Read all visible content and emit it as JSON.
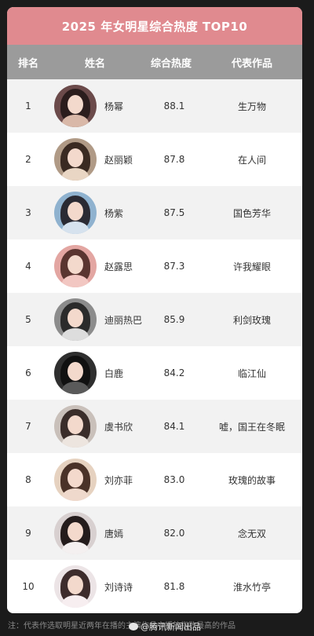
{
  "title": "2025 年女明星综合热度 TOP10",
  "header": {
    "rank": "排名",
    "name": "姓名",
    "score": "综合热度",
    "work": "代表作品"
  },
  "rows": [
    {
      "rank": "1",
      "name": "杨幂",
      "score": "88.1",
      "work": "生万物",
      "bg": "#6b4a4a",
      "hair": "#2b1d1d",
      "body": "#d9b8a8"
    },
    {
      "rank": "2",
      "name": "赵丽颖",
      "score": "87.8",
      "work": "在人间",
      "bg": "#b09a86",
      "hair": "#3a2a22",
      "body": "#e9d6c4"
    },
    {
      "rank": "3",
      "name": "杨紫",
      "score": "87.5",
      "work": "国色芳华",
      "bg": "#8fb2cf",
      "hair": "#2a2a33",
      "body": "#d6e2ee"
    },
    {
      "rank": "4",
      "name": "赵露思",
      "score": "87.3",
      "work": "许我耀眼",
      "bg": "#e3a6a2",
      "hair": "#5a3530",
      "body": "#f2c7c2"
    },
    {
      "rank": "5",
      "name": "迪丽热巴",
      "score": "85.9",
      "work": "利剑玫瑰",
      "bg": "#8c8c8c",
      "hair": "#2b2b2b",
      "body": "#dddddd"
    },
    {
      "rank": "6",
      "name": "白鹿",
      "score": "84.2",
      "work": "临江仙",
      "bg": "#2f2f2f",
      "hair": "#111111",
      "body": "#5a5a5a"
    },
    {
      "rank": "7",
      "name": "虞书欣",
      "score": "84.1",
      "work": "嘘，国王在冬眠",
      "bg": "#c9c0ba",
      "hair": "#3a2d2a",
      "body": "#ede5df"
    },
    {
      "rank": "8",
      "name": "刘亦菲",
      "score": "83.0",
      "work": "玫瑰的故事",
      "bg": "#e6d2c0",
      "hair": "#4a3228",
      "body": "#efd9cc"
    },
    {
      "rank": "9",
      "name": "唐嫣",
      "score": "82.0",
      "work": "念无双",
      "bg": "#d8d0d0",
      "hair": "#241c1c",
      "body": "#f4f0f0"
    },
    {
      "rank": "10",
      "name": "刘诗诗",
      "score": "81.8",
      "work": "淮水竹亭",
      "bg": "#ece4e6",
      "hair": "#3d2c2c",
      "body": "#f7eef0"
    }
  ],
  "footer": "注：代表作选取明星近两年在播的主演作品中播放指数最高的作品",
  "watermark": "@腾讯新闻出品",
  "colors": {
    "title_bar": "#e08a8f",
    "header_bar": "#9b9b9b",
    "row_alt": "#f2f2f2"
  }
}
